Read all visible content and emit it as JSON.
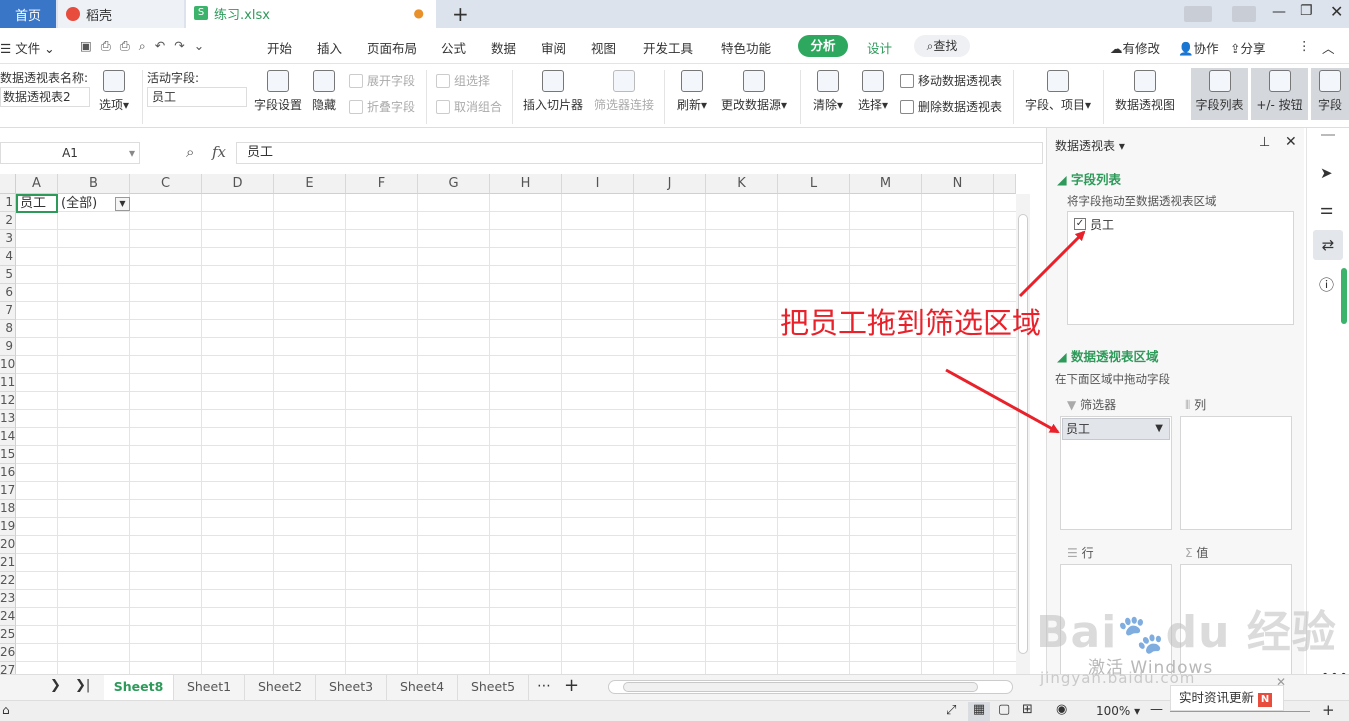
{
  "tabs": {
    "home": "首页",
    "daoke": "稻壳",
    "doc": "练习.xlsx"
  },
  "menu": {
    "file": "文件",
    "items": [
      "开始",
      "插入",
      "页面布局",
      "公式",
      "数据",
      "审阅",
      "视图",
      "开发工具",
      "特色功能"
    ],
    "analyze": "分析",
    "design": "设计",
    "search": "查找",
    "right": [
      "有修改",
      "协作",
      "分享"
    ]
  },
  "ribbon": {
    "pivot_name_label": "数据透视表名称:",
    "pivot_name_value": "数据透视表2",
    "options": "选项",
    "active_field_label": "活动字段:",
    "active_field_value": "员工",
    "field_settings": "字段设置",
    "hide": "隐藏",
    "expand_field": "展开字段",
    "collapse_field": "折叠字段",
    "group_select": "组选择",
    "ungroup": "取消组合",
    "insert_slicer": "插入切片器",
    "filter_connection": "筛选器连接",
    "refresh": "刷新",
    "change_source": "更改数据源",
    "clear": "清除",
    "select": "选择",
    "move_pivot": "移动数据透视表",
    "delete_pivot": "删除数据透视表",
    "fields_items": "字段、项目",
    "pivot_chart": "数据透视图",
    "field_list": "字段列表",
    "pm_button": "+/- 按钮",
    "field_header": "字段"
  },
  "formula_bar": {
    "cell_ref": "A1",
    "fx": "fx",
    "value": "员工"
  },
  "grid": {
    "columns": [
      "A",
      "B",
      "C",
      "D",
      "E",
      "F",
      "G",
      "H",
      "I",
      "J",
      "K",
      "L",
      "M",
      "N"
    ],
    "rows": [
      "1",
      "2",
      "3",
      "4",
      "5",
      "6",
      "7",
      "8",
      "9",
      "10",
      "11",
      "12",
      "13",
      "14",
      "15",
      "16",
      "17",
      "18",
      "19",
      "20",
      "21",
      "22",
      "23",
      "24",
      "25",
      "26",
      "27"
    ],
    "a1": "员工",
    "b1": "(全部)"
  },
  "sheets": [
    "Sheet8",
    "Sheet1",
    "Sheet2",
    "Sheet3",
    "Sheet4",
    "Sheet5"
  ],
  "panel": {
    "title": "数据透视表",
    "field_list_title": "字段列表",
    "field_list_hint": "将字段拖动至数据透视表区域",
    "field_item": "员工",
    "area_title": "数据透视表区域",
    "area_hint": "在下面区域中拖动字段",
    "filter": "筛选器",
    "column": "列",
    "row": "行",
    "value": "值",
    "filter_item": "员工"
  },
  "annotation": "把员工拖到筛选区域",
  "watermark": {
    "activate": "激活 Windows",
    "news": "实时资讯更新",
    "url": "jingyan.baidu.com"
  },
  "status": {
    "zoom": "100%"
  },
  "colors": {
    "accent_green": "#2e9a5a",
    "analyze_bg": "#2ea85f",
    "annotation_red": "#e8212a",
    "home_tab": "#3a76c7"
  }
}
